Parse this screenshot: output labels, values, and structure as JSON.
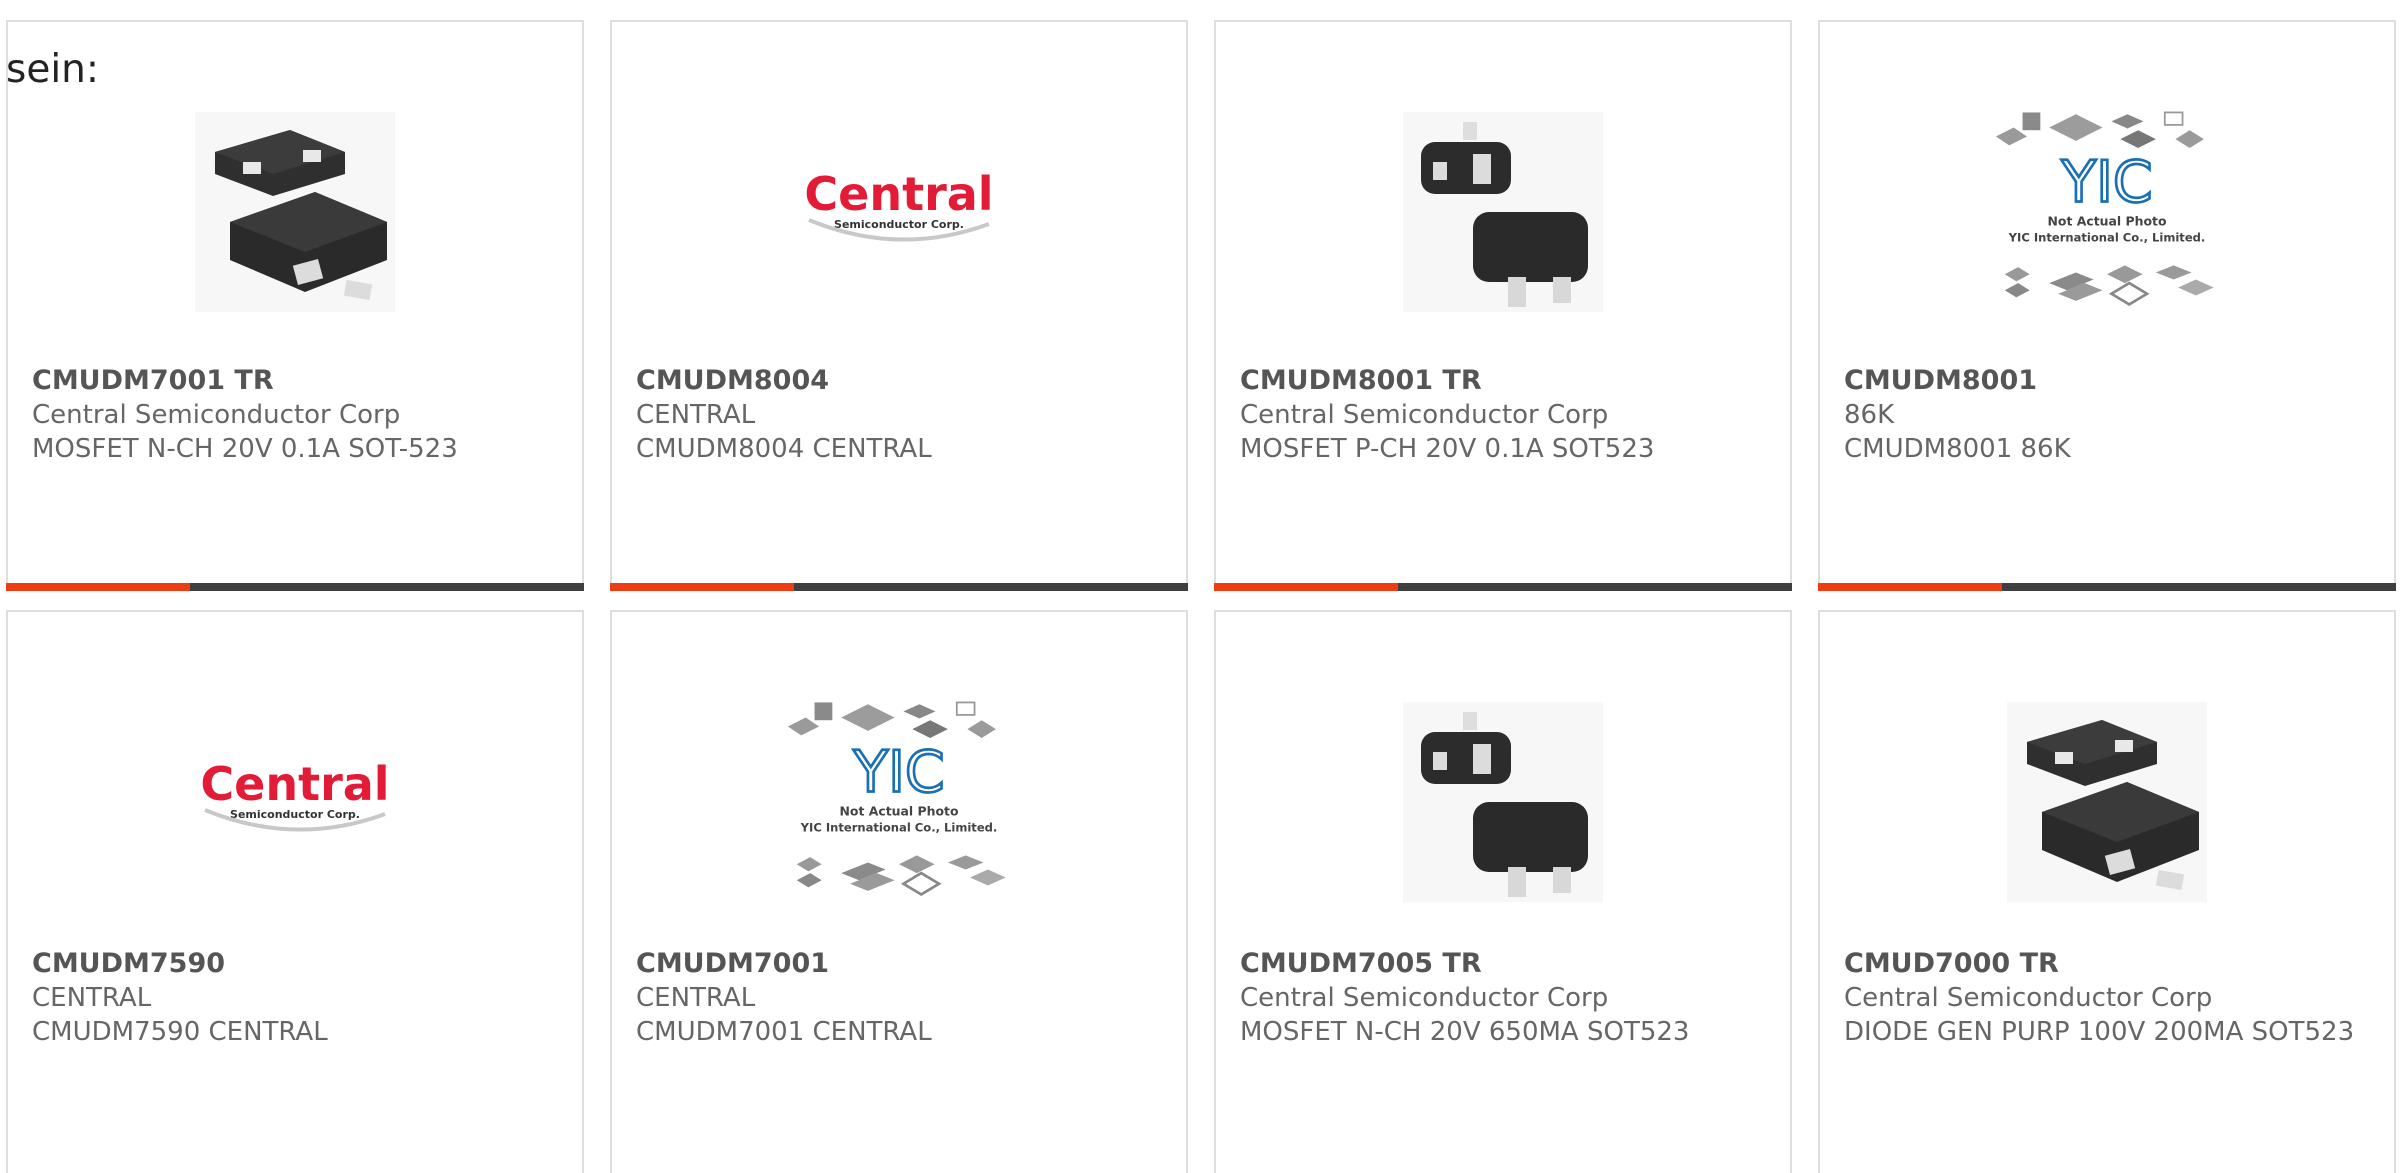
{
  "intro": "sein:",
  "colors": {
    "accent": "#ee3d12",
    "bar_dark": "#3f3f3f",
    "central_red": "#e21b36",
    "yic_blue": "#1b6fb4",
    "chip_black": "#333333"
  },
  "products": [
    {
      "part": "CMUDM7001 TR",
      "maker": "Central Semiconductor Corp",
      "desc": "MOSFET N-CH 20V 0.1A SOT-523",
      "image": "sot523-package-image"
    },
    {
      "part": "CMUDM8004",
      "maker": "CENTRAL",
      "desc": "CMUDM8004 CENTRAL",
      "image": "central-logo-image",
      "logo": {
        "word": "Central",
        "sub": "Semiconductor Corp."
      }
    },
    {
      "part": "CMUDM8001 TR",
      "maker": "Central Semiconductor Corp",
      "desc": "MOSFET P-CH 20V 0.1A SOT523",
      "image": "sot523-package-image"
    },
    {
      "part": "CMUDM8001",
      "maker": "86K",
      "desc": "CMUDM8001 86K",
      "image": "yic-placeholder-image",
      "placeholder": {
        "logo": "YIC",
        "line1": "Not Actual Photo",
        "line2": "YIC International Co., Limited."
      }
    },
    {
      "part": "CMUDM7590",
      "maker": "CENTRAL",
      "desc": "CMUDM7590 CENTRAL",
      "image": "central-logo-image",
      "logo": {
        "word": "Central",
        "sub": "Semiconductor Corp."
      }
    },
    {
      "part": "CMUDM7001",
      "maker": "CENTRAL",
      "desc": "CMUDM7001 CENTRAL",
      "image": "yic-placeholder-image",
      "placeholder": {
        "logo": "YIC",
        "line1": "Not Actual Photo",
        "line2": "YIC International Co., Limited."
      }
    },
    {
      "part": "CMUDM7005 TR",
      "maker": "Central Semiconductor Corp",
      "desc": "MOSFET N-CH 20V 650MA SOT523",
      "image": "sot523-package-image"
    },
    {
      "part": "CMUD7000 TR",
      "maker": "Central Semiconductor Corp",
      "desc": "DIODE GEN PURP 100V 200MA SOT523",
      "image": "sot523-package-image"
    }
  ]
}
